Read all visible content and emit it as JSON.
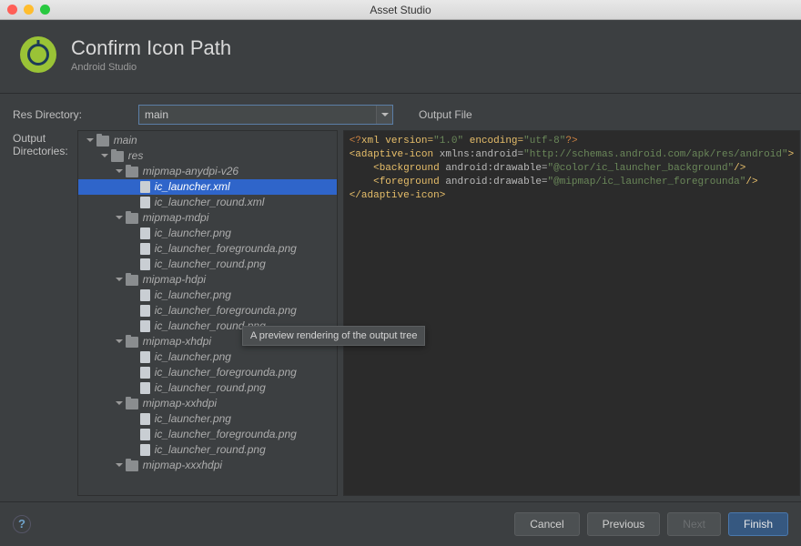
{
  "window": {
    "title": "Asset Studio"
  },
  "header": {
    "title": "Confirm Icon Path",
    "subtitle": "Android Studio"
  },
  "form": {
    "res_dir_label": "Res Directory:",
    "res_dir_value": "main",
    "out_dirs_label": "Output Directories:",
    "output_file_label": "Output File"
  },
  "tree": [
    {
      "depth": 0,
      "kind": "folder",
      "open": true,
      "label": "main"
    },
    {
      "depth": 1,
      "kind": "folder",
      "open": true,
      "label": "res"
    },
    {
      "depth": 2,
      "kind": "folder",
      "open": true,
      "label": "mipmap-anydpi-v26"
    },
    {
      "depth": 3,
      "kind": "file",
      "label": "ic_launcher.xml",
      "selected": true
    },
    {
      "depth": 3,
      "kind": "file",
      "label": "ic_launcher_round.xml"
    },
    {
      "depth": 2,
      "kind": "folder",
      "open": true,
      "label": "mipmap-mdpi"
    },
    {
      "depth": 3,
      "kind": "file",
      "label": "ic_launcher.png"
    },
    {
      "depth": 3,
      "kind": "file",
      "label": "ic_launcher_foregrounda.png"
    },
    {
      "depth": 3,
      "kind": "file",
      "label": "ic_launcher_round.png"
    },
    {
      "depth": 2,
      "kind": "folder",
      "open": true,
      "label": "mipmap-hdpi"
    },
    {
      "depth": 3,
      "kind": "file",
      "label": "ic_launcher.png"
    },
    {
      "depth": 3,
      "kind": "file",
      "label": "ic_launcher_foregrounda.png"
    },
    {
      "depth": 3,
      "kind": "file",
      "label": "ic_launcher_round.png"
    },
    {
      "depth": 2,
      "kind": "folder",
      "open": true,
      "label": "mipmap-xhdpi"
    },
    {
      "depth": 3,
      "kind": "file",
      "label": "ic_launcher.png"
    },
    {
      "depth": 3,
      "kind": "file",
      "label": "ic_launcher_foregrounda.png"
    },
    {
      "depth": 3,
      "kind": "file",
      "label": "ic_launcher_round.png"
    },
    {
      "depth": 2,
      "kind": "folder",
      "open": true,
      "label": "mipmap-xxhdpi"
    },
    {
      "depth": 3,
      "kind": "file",
      "label": "ic_launcher.png"
    },
    {
      "depth": 3,
      "kind": "file",
      "label": "ic_launcher_foregrounda.png"
    },
    {
      "depth": 3,
      "kind": "file",
      "label": "ic_launcher_round.png"
    },
    {
      "depth": 2,
      "kind": "folder",
      "open": true,
      "label": "mipmap-xxxhdpi"
    }
  ],
  "tooltip": "A preview rendering of the output tree",
  "xml": {
    "line1_a": "<?",
    "line1_b": "xml version=",
    "line1_c": "\"1.0\"",
    "line1_d": " encoding=",
    "line1_e": "\"utf-8\"",
    "line1_f": "?>",
    "l2a": "<adaptive-icon ",
    "l2b": "xmlns:android=",
    "l2c": "\"http://schemas.android.com/apk/res/android\"",
    "l2d": ">",
    "l3a": "    <background ",
    "l3b": "android:drawable=",
    "l3c": "\"@color/ic_launcher_background\"",
    "l3d": "/>",
    "l4a": "    <foreground ",
    "l4b": "android:drawable=",
    "l4c": "\"@mipmap/ic_launcher_foregrounda\"",
    "l4d": "/>",
    "l5": "</adaptive-icon>"
  },
  "footer": {
    "help": "?",
    "cancel": "Cancel",
    "previous": "Previous",
    "next": "Next",
    "finish": "Finish"
  }
}
